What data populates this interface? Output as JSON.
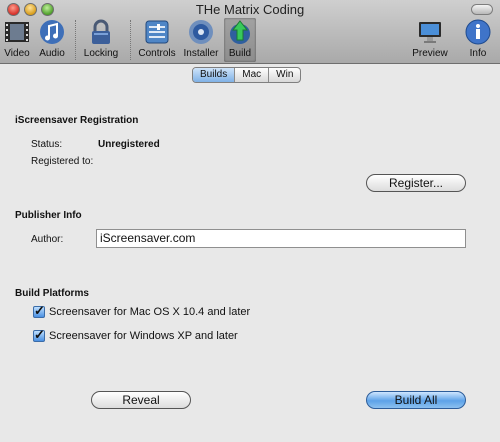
{
  "window": {
    "title": "THe Matrix Coding"
  },
  "toolbar": {
    "items": [
      {
        "label": "Video",
        "icon": "video-icon"
      },
      {
        "label": "Audio",
        "icon": "audio-icon"
      },
      {
        "label": "Locking",
        "icon": "lock-icon"
      },
      {
        "label": "Controls",
        "icon": "controls-icon"
      },
      {
        "label": "Installer",
        "icon": "installer-icon"
      },
      {
        "label": "Build",
        "icon": "build-icon",
        "selected": true
      },
      {
        "label": "Preview",
        "icon": "preview-icon"
      },
      {
        "label": "Info",
        "icon": "info-icon"
      }
    ]
  },
  "tabs": [
    {
      "label": "Builds",
      "active": true
    },
    {
      "label": "Mac",
      "active": false
    },
    {
      "label": "Win",
      "active": false
    }
  ],
  "registration": {
    "heading": "iScreensaver Registration",
    "status_label": "Status:",
    "status_value": "Unregistered",
    "registered_label": "Registered to:",
    "register_button": "Register..."
  },
  "publisher": {
    "heading": "Publisher Info",
    "author_label": "Author:",
    "author_value": "iScreensaver.com"
  },
  "platforms": {
    "heading": "Build Platforms",
    "options": [
      {
        "label": "Screensaver for Mac OS X 10.4 and later",
        "checked": true
      },
      {
        "label": "Screensaver for Windows XP and later",
        "checked": true
      }
    ]
  },
  "footer": {
    "reveal_button": "Reveal",
    "build_all_button": "Build All"
  },
  "colors": {
    "accent": "#5da2e8",
    "window_bg": "#e8e8e8"
  }
}
